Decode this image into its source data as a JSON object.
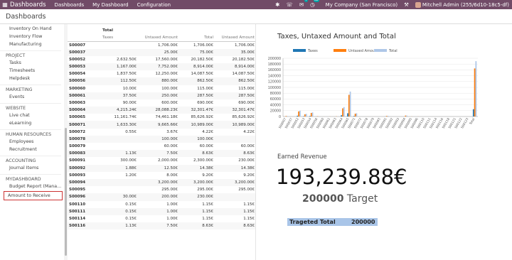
{
  "topbar": {
    "app_title": "Dashboards",
    "menus": [
      "Dashboards",
      "My Dashboard",
      "Configuration"
    ],
    "chat_badge": "7",
    "activity_badge": "62",
    "company": "My Company (San Francisco)",
    "user": "Mitchell Admin (255/6d10-18c5-df)"
  },
  "page_title": "Dashboards",
  "sidebar": {
    "groups": [
      {
        "label": "",
        "items": [
          "Inventory On Hand",
          "Inventory Flow",
          "Manufacturing"
        ]
      },
      {
        "label": "PROJECT",
        "items": [
          "Tasks",
          "Timesheets",
          "Helpdesk"
        ]
      },
      {
        "label": "MARKETING",
        "items": [
          "Events"
        ]
      },
      {
        "label": "WEBSITE",
        "items": [
          "Live chat",
          "eLearning"
        ]
      },
      {
        "label": "HUMAN RESOURCES",
        "items": [
          "Employees",
          "Recruitment"
        ]
      },
      {
        "label": "ACCOUNTING",
        "items": [
          "Journal Items"
        ]
      },
      {
        "label": "MYDASHBOARD",
        "items": [
          "Budget Report (Mana...",
          "Amount to Receive"
        ]
      }
    ],
    "active_item": "Amount to Receive"
  },
  "table": {
    "group_header": "Total",
    "columns": [
      "Taxes",
      "Untaxed Amount",
      "Total",
      "Untaxed Amount"
    ],
    "rows": [
      [
        "S00007",
        "",
        "1,706.00€",
        "1,706.00€",
        "1,706.00€"
      ],
      [
        "S00037",
        "",
        "25.00€",
        "75.00€",
        "35.00€"
      ],
      [
        "S00052",
        "2,632.50€",
        "17,560.00€",
        "20,182.50€",
        "20,182.50€"
      ],
      [
        "S00053",
        "1,167.00€",
        "7,752.00€",
        "8,914.00€",
        "8,914.00€"
      ],
      [
        "S00054",
        "1,837.50€",
        "12,250.00€",
        "14,087.50€",
        "14,087.50€"
      ],
      [
        "S00056",
        "112.50€",
        "880.00€",
        "862.50€",
        "862.50€"
      ],
      [
        "S00060",
        "10.00€",
        "100.00€",
        "115.00€",
        "115.00€"
      ],
      [
        "S00061",
        "37.50€",
        "250.00€",
        "287.50€",
        "287.50€"
      ],
      [
        "S00063",
        "90.00€",
        "600.00€",
        "690.00€",
        "690.00€"
      ],
      [
        "S00064",
        "4,215.24€",
        "28,088.23€",
        "32,301.47€",
        "32,301.47€"
      ],
      [
        "S00065",
        "11,161.74€",
        "74,461.18€",
        "85,626.92€",
        "85,626.92€"
      ],
      [
        "S00071",
        "1,633.30€",
        "9,665.66€",
        "10,989.00€",
        "10,989.00€"
      ],
      [
        "S00072",
        "0.55€",
        "3.67€",
        "4.22€",
        "4.22€"
      ],
      [
        "S00078",
        "",
        "100.00€",
        "100.00€",
        ""
      ],
      [
        "S00079",
        "",
        "60.00€",
        "60.00€",
        "60.00€"
      ],
      [
        "S00083",
        "1.13€",
        "7.50€",
        "8.63€",
        "8.63€"
      ],
      [
        "S00091",
        "300.00€",
        "2,000.00€",
        "2,300.00€",
        "230.00€"
      ],
      [
        "S00092",
        "1.88€",
        "12.50€",
        "14.38€",
        "14.38€"
      ],
      [
        "S00093",
        "1.20€",
        "8.00€",
        "9.20€",
        "9.20€"
      ],
      [
        "S00094",
        "",
        "3,200.00€",
        "3,200.00€",
        "3,200.00€"
      ],
      [
        "S00095",
        "",
        "295.00€",
        "295.00€",
        "295.00€"
      ],
      [
        "S00096",
        "30.00€",
        "200.00€",
        "230.00€",
        ""
      ],
      [
        "S00110",
        "0.15€",
        "1.00€",
        "1.15€",
        "1.15€"
      ],
      [
        "S00111",
        "0.15€",
        "1.00€",
        "1.15€",
        "1.15€"
      ],
      [
        "S00114",
        "0.15€",
        "1.00€",
        "1.15€",
        "1.15€"
      ],
      [
        "S00116",
        "1.13€",
        "7.50€",
        "8.63€",
        "8.63€"
      ]
    ]
  },
  "chart_data": {
    "type": "bar",
    "title": "Taxes, Untaxed Amount and Total",
    "legend_position": "top",
    "colors": {
      "Taxes": "#1f77b4",
      "Untaxed Amount": "#ff7f0e",
      "Total": "#aec7e8"
    },
    "ylim": [
      0,
      200000
    ],
    "yticks": [
      "200000",
      "180000",
      "160000",
      "140000",
      "120000",
      "100000",
      "80000",
      "60000",
      "40000",
      "20000",
      "0"
    ],
    "categories": [
      "S00007",
      "S00037",
      "S00052",
      "S00053",
      "S00054",
      "S00056",
      "S00060",
      "S00061",
      "S00063",
      "S00064",
      "S00065",
      "S00071",
      "S00072",
      "S00078",
      "S00079",
      "S00083",
      "S00091",
      "S00092",
      "S00093",
      "S00094",
      "S00095",
      "S00096",
      "S00110",
      "S00111",
      "S00114",
      "S00116",
      "S00118",
      "S00121",
      "S00122",
      "S00123",
      "Total"
    ],
    "series": [
      {
        "name": "Taxes",
        "values": [
          0,
          0,
          2632,
          1167,
          1837,
          112,
          10,
          37,
          90,
          4215,
          11161,
          1633,
          1,
          0,
          0,
          1,
          300,
          2,
          1,
          0,
          0,
          30,
          0,
          0,
          0,
          1,
          0,
          0,
          0,
          0,
          25000
        ]
      },
      {
        "name": "Untaxed Amount",
        "values": [
          1706,
          25,
          17560,
          7752,
          12250,
          880,
          100,
          250,
          600,
          28088,
          74461,
          9665,
          4,
          100,
          60,
          8,
          2000,
          13,
          8,
          3200,
          295,
          200,
          1,
          1,
          1,
          8,
          0,
          0,
          0,
          0,
          165000
        ]
      },
      {
        "name": "Total",
        "values": [
          1706,
          75,
          20182,
          8914,
          14087,
          862,
          115,
          287,
          690,
          32301,
          85626,
          10989,
          4,
          100,
          60,
          9,
          2300,
          14,
          9,
          3200,
          295,
          230,
          1,
          1,
          1,
          9,
          0,
          0,
          0,
          0,
          190000
        ]
      }
    ]
  },
  "kpi": {
    "label": "Earned Revenue",
    "value": "193,239.88€",
    "target_value": "200000",
    "target_label": "Target"
  },
  "targeted_total": {
    "label": "Trageted Total",
    "value": "200000"
  }
}
